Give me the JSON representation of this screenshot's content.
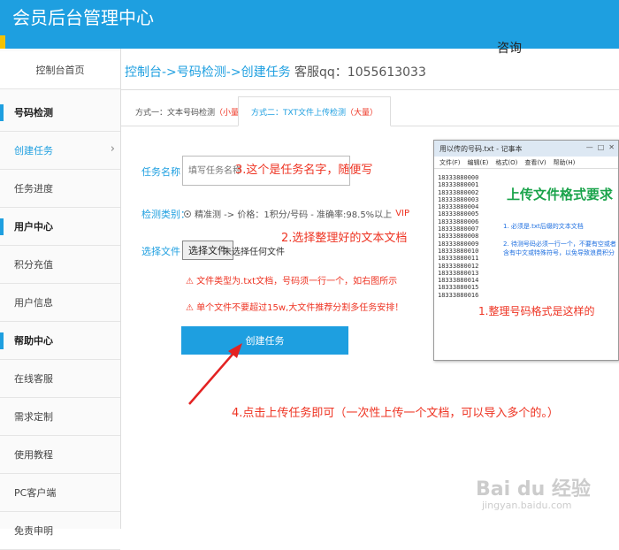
{
  "header": {
    "title": "会员后台管理中心",
    "consult": "咨询"
  },
  "sidebar": {
    "items": [
      {
        "label": "控制台首页"
      },
      {
        "label": "号码检测"
      },
      {
        "label": "创建任务"
      },
      {
        "label": "任务进度"
      },
      {
        "label": "用户中心"
      },
      {
        "label": "积分充值"
      },
      {
        "label": "用户信息"
      },
      {
        "label": "帮助中心"
      },
      {
        "label": "在线客服"
      },
      {
        "label": "需求定制"
      },
      {
        "label": "使用教程"
      },
      {
        "label": "PC客户端"
      },
      {
        "label": "免责申明"
      }
    ]
  },
  "breadcrumb": {
    "path": "控制台->号码检测->创建任务",
    "service": "客服qq：1055613033"
  },
  "tabs": [
    {
      "label": "方式一：文本号码检测",
      "tag": "（小量）"
    },
    {
      "label": "方式二：TXT文件上传检测",
      "tag": "（大量）"
    }
  ],
  "form": {
    "task_name_label": "任务名称：",
    "task_name_placeholder": "填写任务名称",
    "type_label": "检测类别：",
    "type_option": "精准测 -> 价格：1积分/号码 - 准确率:98.5%以上",
    "type_vip": "VIP",
    "file_label": "选择文件：",
    "file_button": "选择文件",
    "file_none": "未选择任何文件",
    "warn1": "⚠ 文件类型为.txt文档，号码须一行一个，如右图所示",
    "warn2": "⚠ 单个文件不要超过15w,大文件推荐分割多任务安排！",
    "submit": "创建任务"
  },
  "annotations": {
    "a3": "3.这个是任务名字，随便写",
    "a2": "2.选择整理好的文本文档",
    "a1": "1.整理号码格式是这样的",
    "a4": "4.点击上传任务即可（一次性上传一个文档，可以导入多个的。）"
  },
  "notepad": {
    "title": "用以传的号码.txt - 记事本",
    "controls": [
      "—",
      "□",
      "✕"
    ],
    "menu": [
      "文件(F)",
      "编辑(E)",
      "格式(O)",
      "查看(V)",
      "帮助(H)"
    ],
    "lines": [
      "18333880000",
      "18333880001",
      "18333880002",
      "18333880003",
      "18333880004",
      "18333880005",
      "18333880006",
      "18333880007",
      "18333880008",
      "18333880009",
      "18333880010",
      "18333880011",
      "18333880012",
      "18333880013",
      "18333880014",
      "18333880015",
      "18333880016"
    ],
    "heading": "上传文件格式要求",
    "note1": "1. 必须是.txt后缀的文本文档",
    "note2": "2. 待测号码必须一行一个，不要有空或者含有中文或特殊符号，以免导致浪费积分"
  },
  "watermark": {
    "brand": "Bai du 经验",
    "url": "jingyan.baidu.com"
  },
  "colors": {
    "primary": "#1e9fe0",
    "accent": "#e32222",
    "note_green": "#19a34a"
  }
}
